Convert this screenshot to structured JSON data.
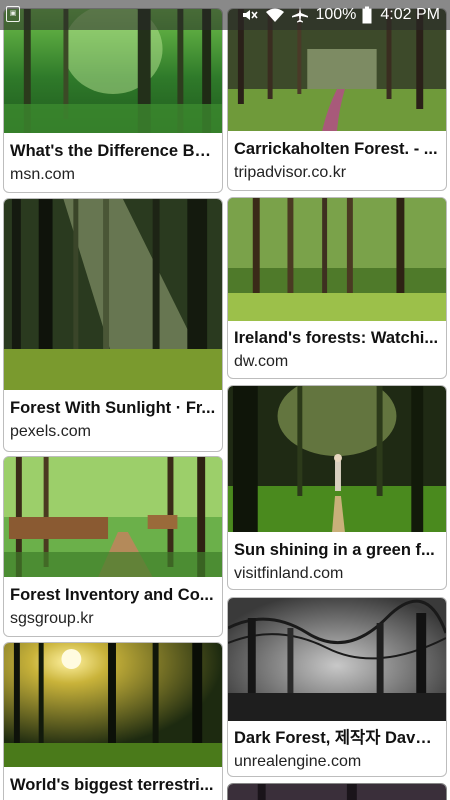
{
  "status_bar": {
    "notification_icon": "photo-icon",
    "icons": [
      "mute-icon",
      "wifi-icon",
      "airplane-icon"
    ],
    "battery_percent": "100%",
    "battery_icon": "battery-icon",
    "time": "4:02 PM"
  },
  "results": {
    "left_column": [
      {
        "title": "What's the Difference Be...",
        "source": "msn.com",
        "image": "forest-green-light"
      },
      {
        "title": "Forest With Sunlight · Fr...",
        "source": "pexels.com",
        "image": "forest-sunbeams"
      },
      {
        "title": "Forest Inventory and Co...",
        "source": "sgsgroup.kr",
        "image": "forest-logs-path"
      },
      {
        "title": "World's biggest terrestri...",
        "source": "",
        "image": "forest-sunset"
      }
    ],
    "right_column": [
      {
        "title": "Carrickaholten Forest. - ...",
        "source": "tripadvisor.co.kr",
        "image": "forest-path"
      },
      {
        "title": "Ireland's forests: Watchi...",
        "source": "dw.com",
        "image": "forest-bright"
      },
      {
        "title": "Sun shining in a green f...",
        "source": "visitfinland.com",
        "image": "forest-walker"
      },
      {
        "title": "Dark Forest, 제작자 Dave ...",
        "source": "unrealengine.com",
        "image": "forest-dark"
      },
      {
        "title": "",
        "source": "",
        "image": "forest-dark-partial"
      }
    ]
  }
}
